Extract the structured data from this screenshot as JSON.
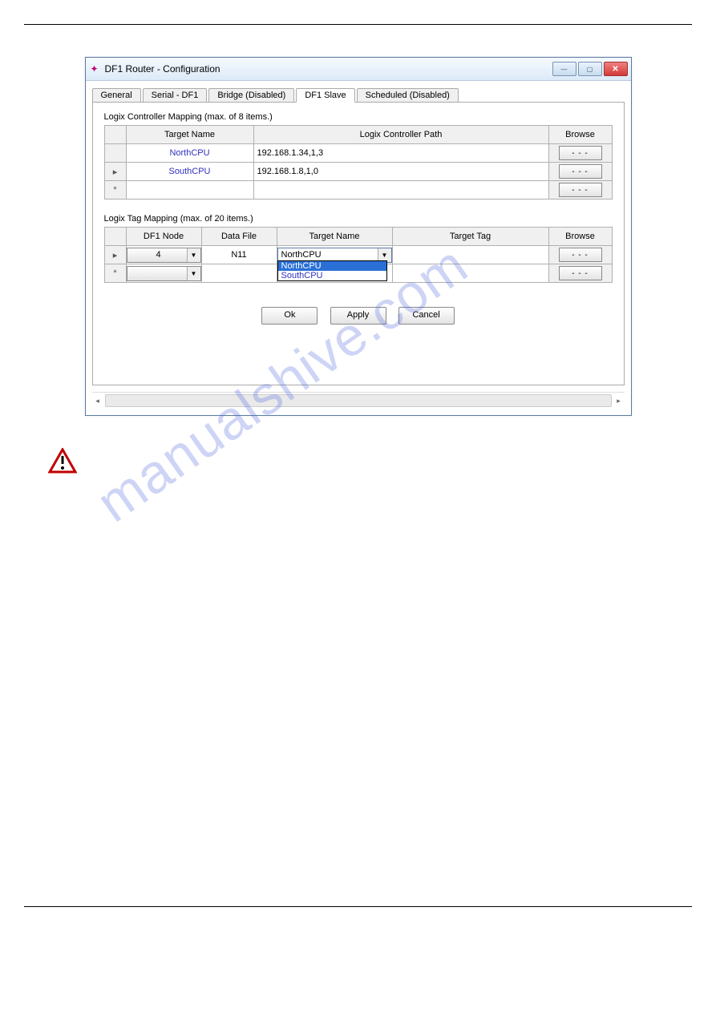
{
  "window": {
    "title": "DF1 Router - Configuration"
  },
  "tabs": {
    "general": "General",
    "serial": "Serial - DF1",
    "bridge": "Bridge (Disabled)",
    "df1slave": "DF1 Slave",
    "scheduled": "Scheduled (Disabled)"
  },
  "controller_mapping": {
    "label": "Logix Controller Mapping (max. of 8 items.)",
    "headers": {
      "target": "Target Name",
      "path": "Logix Controller Path",
      "browse": "Browse"
    },
    "rows": [
      {
        "marker": "",
        "name": "NorthCPU",
        "path": "192.168.1.34,1,3"
      },
      {
        "marker": "▸",
        "name": "SouthCPU",
        "path": "192.168.1.8,1,0"
      },
      {
        "marker": "*",
        "name": "",
        "path": ""
      }
    ],
    "browse_label": "- - -"
  },
  "tag_mapping": {
    "label": "Logix Tag Mapping (max. of 20 items.)",
    "headers": {
      "node": "DF1 Node",
      "file": "Data File",
      "target": "Target Name",
      "tag": "Target Tag",
      "browse": "Browse"
    },
    "rows": [
      {
        "marker": "▸",
        "node": "4",
        "file": "N11",
        "target": "NorthCPU",
        "tag": ""
      },
      {
        "marker": "*",
        "node": "",
        "file": "",
        "target": "",
        "tag": ""
      }
    ],
    "dropdown_options": {
      "opt1": "NorthCPU",
      "opt2": "SouthCPU"
    },
    "browse_label": "- - -"
  },
  "buttons": {
    "ok": "Ok",
    "apply": "Apply",
    "cancel": "Cancel"
  },
  "watermark": "manualshive.com"
}
